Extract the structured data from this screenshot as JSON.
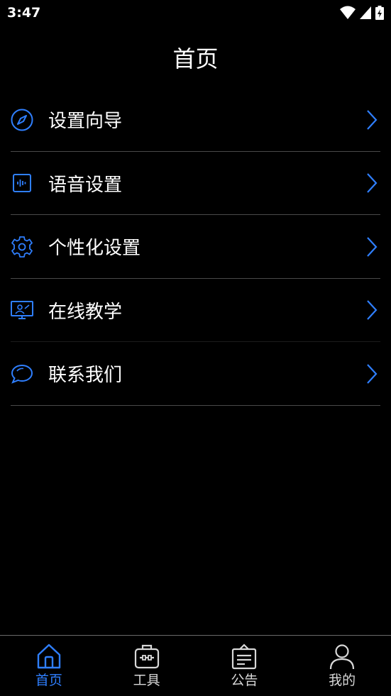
{
  "status_bar": {
    "time": "3:47"
  },
  "header": {
    "title": "首页"
  },
  "menu": {
    "items": [
      {
        "label": "设置向导",
        "icon": "compass-icon"
      },
      {
        "label": "语音设置",
        "icon": "voice-icon"
      },
      {
        "label": "个性化设置",
        "icon": "gear-icon"
      },
      {
        "label": "在线教学",
        "icon": "online-teaching-icon"
      },
      {
        "label": "联系我们",
        "icon": "chat-bubble-icon"
      }
    ]
  },
  "tab_bar": {
    "tabs": [
      {
        "label": "首页",
        "icon": "home-icon",
        "active": true
      },
      {
        "label": "工具",
        "icon": "toolbox-icon",
        "active": false
      },
      {
        "label": "公告",
        "icon": "notice-board-icon",
        "active": false
      },
      {
        "label": "我的",
        "icon": "person-icon",
        "active": false
      }
    ]
  },
  "colors": {
    "accent": "#2f7fff",
    "background": "#000000",
    "text": "#ffffff",
    "divider": "#4a4a4a"
  }
}
